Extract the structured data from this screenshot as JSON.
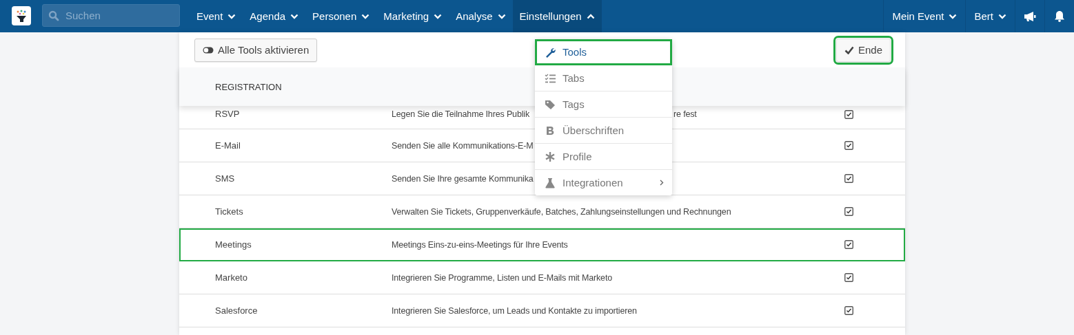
{
  "navbar": {
    "search": {
      "placeholder": "Suchen"
    },
    "menu": [
      {
        "label": "Event",
        "selected": false
      },
      {
        "label": "Agenda",
        "selected": false
      },
      {
        "label": "Personen",
        "selected": false
      },
      {
        "label": "Marketing",
        "selected": false
      },
      {
        "label": "Analyse",
        "selected": false
      },
      {
        "label": "Einstellungen",
        "selected": true
      }
    ],
    "right_menu": [
      {
        "label": "Mein Event"
      },
      {
        "label": "Bert"
      }
    ]
  },
  "toolbar": {
    "toggle_button": "Alle Tools aktivieren",
    "done_button": {
      "label": "Ende",
      "highlighted": true
    }
  },
  "table": {
    "section": "REGISTRATION",
    "rows": [
      {
        "name": "RSVP",
        "description": "Legen Sie die Teilnahme Ihres Publik",
        "description_tail": "re fest",
        "checked": true,
        "highlighted": false
      },
      {
        "name": "E-Mail",
        "description": "Senden Sie alle Kommunikations-E-M",
        "checked": true,
        "highlighted": false
      },
      {
        "name": "SMS",
        "description": "Senden Sie Ihre gesamte Kommunika",
        "checked": true,
        "highlighted": false
      },
      {
        "name": "Tickets",
        "description": "Verwalten Sie Tickets, Gruppenverkäufe, Batches, Zahlungseinstellungen und Rechnungen",
        "checked": true,
        "highlighted": false
      },
      {
        "name": "Meetings",
        "description": "Meetings Eins-zu-eins-Meetings für Ihre Events",
        "checked": true,
        "highlighted": true
      },
      {
        "name": "Marketo",
        "description": "Integrieren Sie Programme, Listen und E-Mails mit Marketo",
        "checked": true,
        "highlighted": false
      },
      {
        "name": "Salesforce",
        "description": "Integrieren Sie Salesforce, um Leads und Kontakte zu importieren",
        "checked": true,
        "highlighted": false
      }
    ]
  },
  "dropdown": {
    "items": [
      {
        "kind": "wrench",
        "label": "Tools",
        "selected": true,
        "highlighted": true
      },
      {
        "kind": "checklist",
        "label": "Tabs",
        "selected": false,
        "highlighted": false
      },
      {
        "kind": "tags",
        "label": "Tags",
        "selected": false,
        "highlighted": false
      },
      {
        "kind": "bold",
        "label": "Überschriften",
        "selected": false,
        "highlighted": false
      },
      {
        "kind": "asterisk",
        "label": "Profile",
        "selected": false,
        "highlighted": false
      },
      {
        "kind": "flask",
        "label": "Integrationen",
        "selected": false,
        "highlighted": false,
        "submenu": true
      }
    ]
  }
}
